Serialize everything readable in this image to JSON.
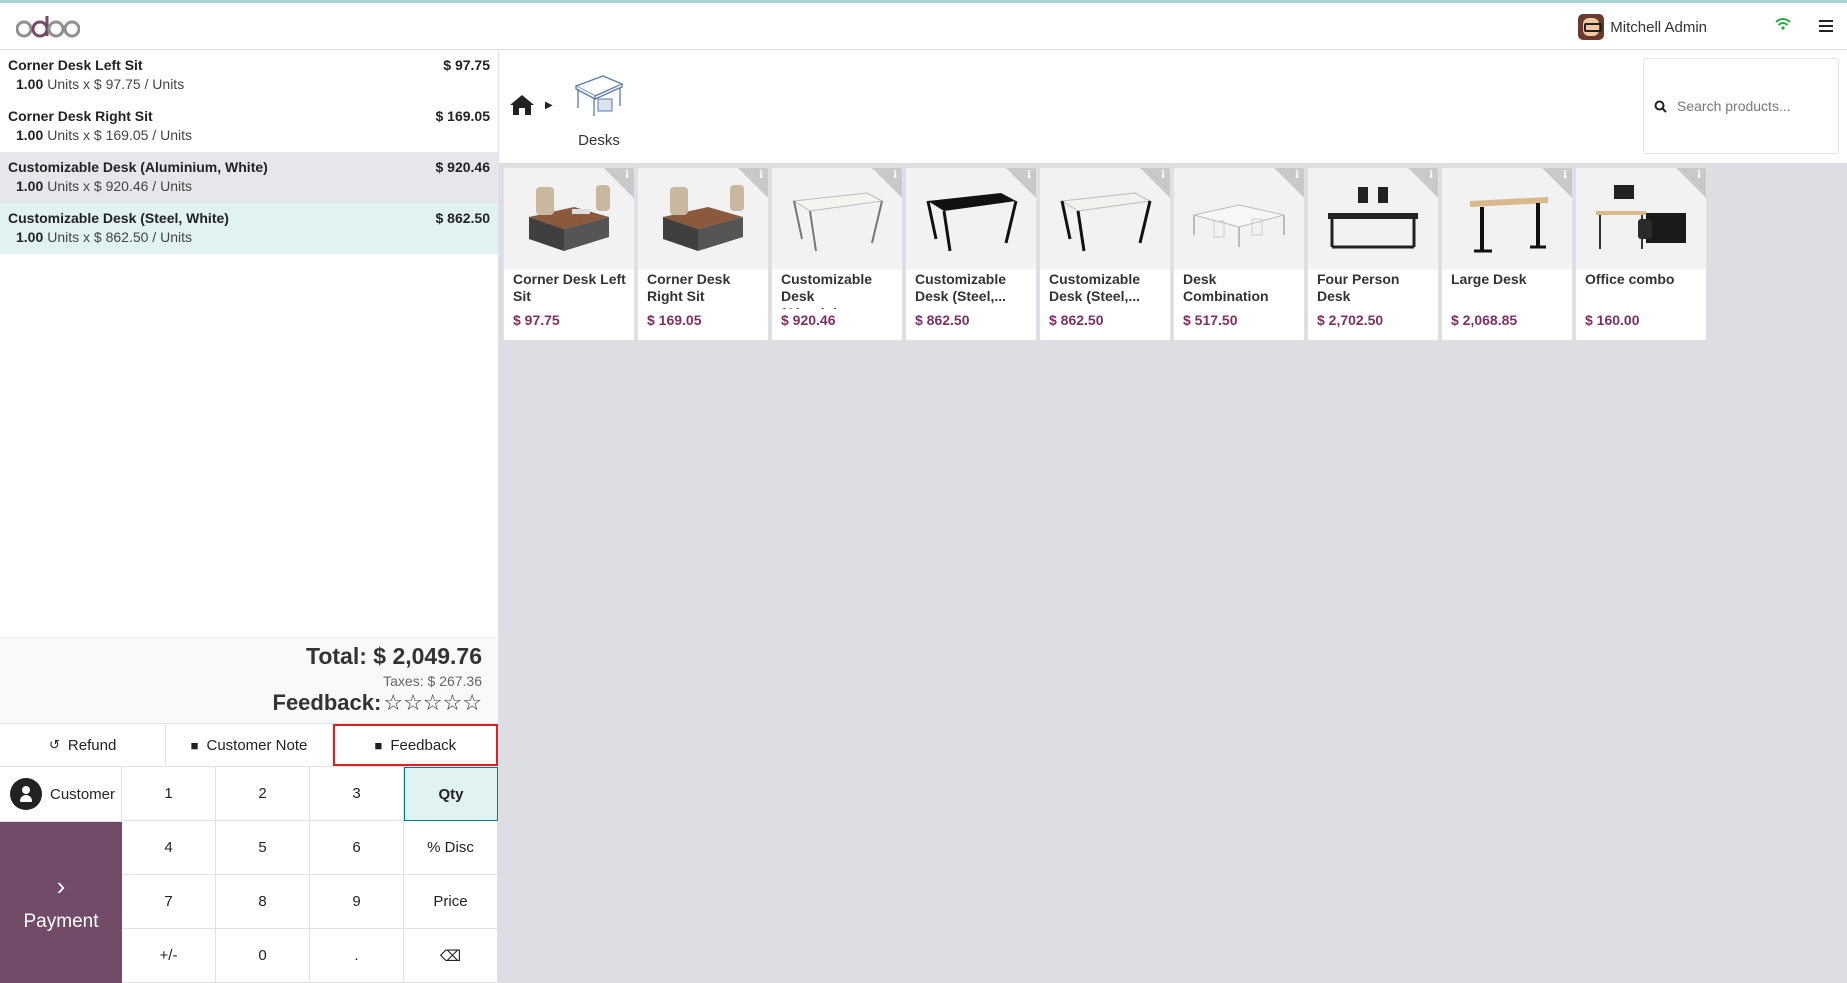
{
  "app": {
    "logo_text": "odoo",
    "user_name": "Mitchell Admin"
  },
  "order": {
    "lines": [
      {
        "name": "Corner Desk Left Sit",
        "price": "$ 97.75",
        "qty": "1.00",
        "detail": "Units x $ 97.75 / Units"
      },
      {
        "name": "Corner Desk Right Sit",
        "price": "$ 169.05",
        "qty": "1.00",
        "detail": "Units x $ 169.05 / Units"
      },
      {
        "name": "Customizable Desk (Aluminium, White)",
        "price": "$ 920.46",
        "qty": "1.00",
        "detail": "Units x $ 920.46 / Units"
      },
      {
        "name": "Customizable Desk (Steel, White)",
        "price": "$ 862.50",
        "qty": "1.00",
        "detail": "Units x $ 862.50 / Units"
      }
    ],
    "total": "Total: $ 2,049.76",
    "taxes": "Taxes: $ 267.36",
    "feedback_label": "Feedback:",
    "feedback_stars": 0
  },
  "controls": {
    "refund": "Refund",
    "customer_note": "Customer Note",
    "feedback": "Feedback"
  },
  "pad": {
    "customer": "Customer",
    "payment": "Payment",
    "keys": [
      "1",
      "2",
      "3",
      "Qty",
      "4",
      "5",
      "6",
      "% Disc",
      "7",
      "8",
      "9",
      "Price",
      "+/-",
      "0",
      ".",
      "⌫"
    ],
    "active_mode": "Qty"
  },
  "catalog": {
    "category": "Desks",
    "search_placeholder": "Search products...",
    "products": [
      {
        "name": "Corner Desk Left Sit",
        "price": "$ 97.75",
        "icon": "corner-desk"
      },
      {
        "name": "Corner Desk Right Sit",
        "price": "$ 169.05",
        "icon": "corner-desk"
      },
      {
        "name": "Customizable Desk (Aluminiu...",
        "price": "$ 920.46",
        "icon": "white-desk"
      },
      {
        "name": "Customizable Desk (Steel,...",
        "price": "$ 862.50",
        "icon": "black-desk"
      },
      {
        "name": "Customizable Desk (Steel,...",
        "price": "$ 862.50",
        "icon": "white-desk"
      },
      {
        "name": "Desk Combination",
        "price": "$ 517.50",
        "icon": "combo-desk"
      },
      {
        "name": "Four Person Desk",
        "price": "$ 2,702.50",
        "icon": "four-person-desk"
      },
      {
        "name": "Large Desk",
        "price": "$ 2,068.85",
        "icon": "large-desk"
      },
      {
        "name": "Office combo",
        "price": "$ 160.00",
        "icon": "office-combo"
      }
    ]
  },
  "colors": {
    "brand": "#714b67",
    "price": "#7c3064",
    "selection": "#e0f2f1",
    "highlight_box": "#e02020"
  }
}
